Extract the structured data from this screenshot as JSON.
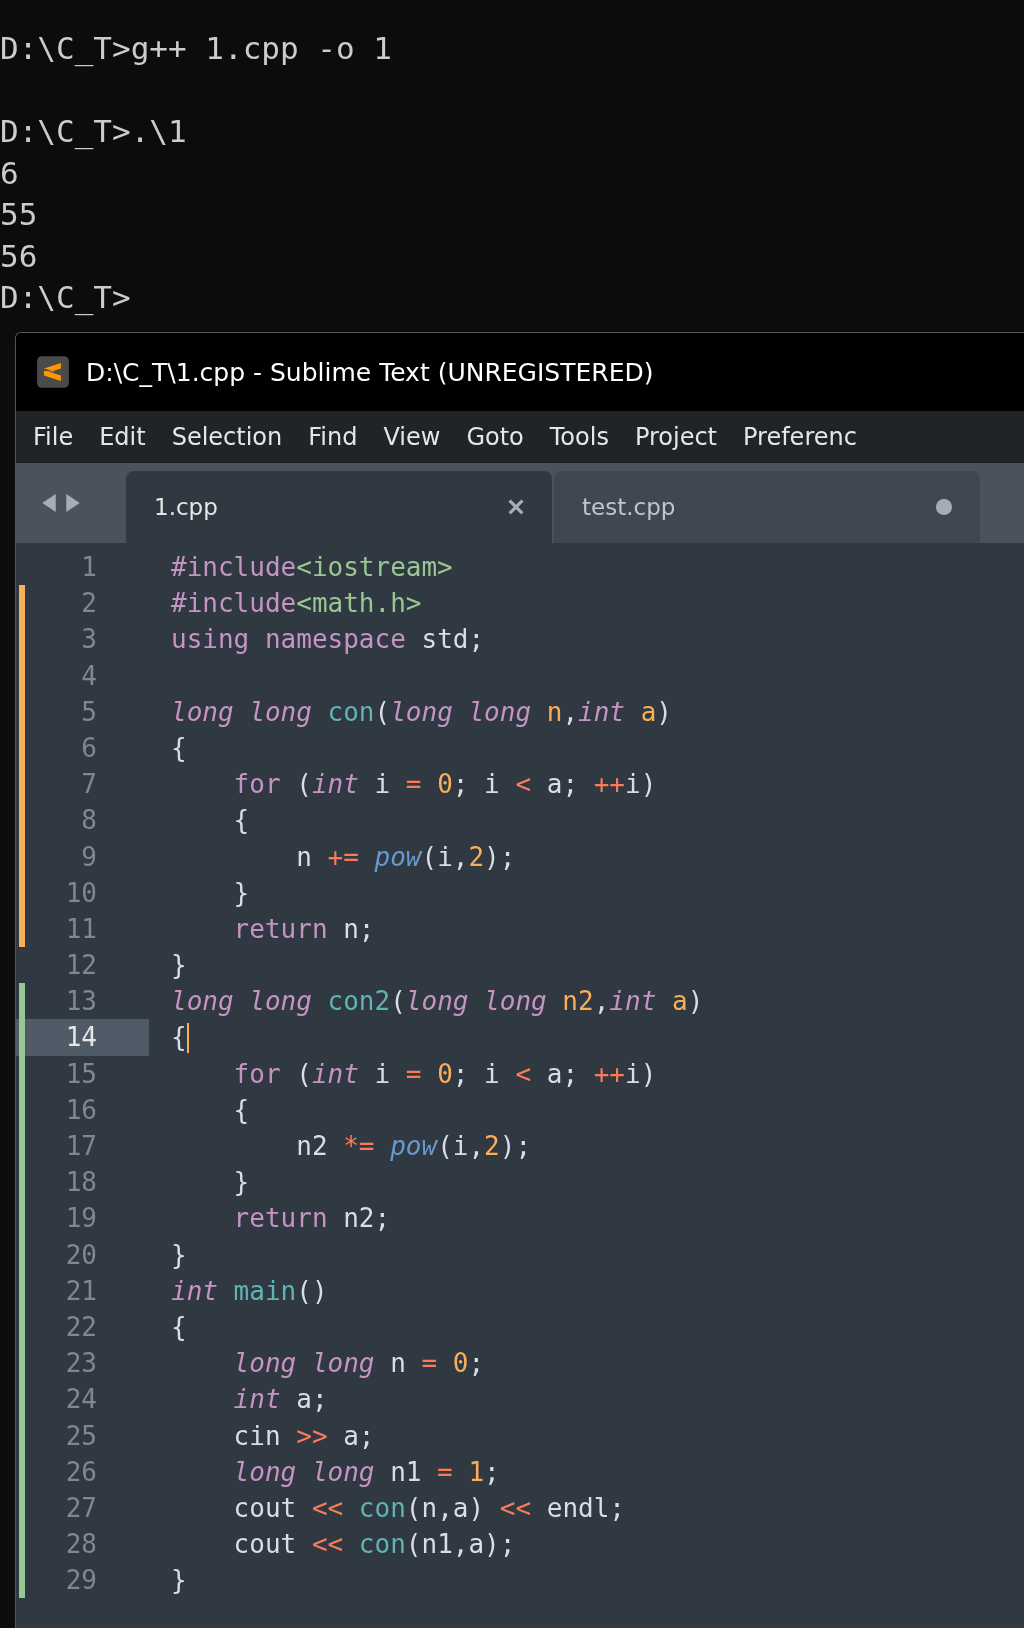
{
  "terminal": {
    "blocks": [
      {
        "lines": [
          "D:\\C_T>g++ 1.cpp -o 1"
        ]
      },
      {
        "lines": [
          "D:\\C_T>.\\1",
          "6",
          "55",
          "56",
          "D:\\C_T>"
        ]
      }
    ]
  },
  "window": {
    "title": "D:\\C_T\\1.cpp - Sublime Text (UNREGISTERED)"
  },
  "menu": [
    "File",
    "Edit",
    "Selection",
    "Find",
    "View",
    "Goto",
    "Tools",
    "Project",
    "Preferenc"
  ],
  "tabs": [
    {
      "label": "1.cpp",
      "selected": true,
      "dirty": false
    },
    {
      "label": "test.cpp",
      "selected": false,
      "dirty": true
    }
  ],
  "editor": {
    "lines": [
      {
        "number": "1",
        "modified": false,
        "added": false,
        "current": false,
        "tokens": [
          {
            "kind": "kw",
            "text": "#include"
          },
          {
            "kind": "str",
            "text": "<iostream>"
          }
        ]
      },
      {
        "number": "2",
        "modified": true,
        "added": false,
        "current": false,
        "tokens": [
          {
            "kind": "kw",
            "text": "#include"
          },
          {
            "kind": "str",
            "text": "<math.h>"
          }
        ]
      },
      {
        "number": "3",
        "modified": true,
        "added": false,
        "current": false,
        "tokens": [
          {
            "kind": "kw",
            "text": "using"
          },
          {
            "kind": "kw",
            "text": " namespace"
          },
          {
            "kind": "plain",
            "text": " std;"
          }
        ]
      },
      {
        "number": "4",
        "modified": true,
        "added": false,
        "current": false
      },
      {
        "number": "5",
        "modified": true,
        "added": false,
        "current": false,
        "tokens": [
          {
            "kind": "type",
            "text": "long long"
          },
          {
            "kind": "fn",
            "text": " con"
          },
          {
            "kind": "plain",
            "text": "("
          },
          {
            "kind": "type",
            "text": "long long"
          },
          {
            "kind": "param",
            "text": " n"
          },
          {
            "kind": "plain",
            "text": ","
          },
          {
            "kind": "type",
            "text": "int"
          },
          {
            "kind": "param",
            "text": " a"
          },
          {
            "kind": "plain",
            "text": ")"
          }
        ]
      },
      {
        "number": "6",
        "modified": true,
        "added": false,
        "current": false,
        "tokens": [
          {
            "kind": "plain",
            "text": "{"
          }
        ]
      },
      {
        "number": "7",
        "modified": true,
        "added": false,
        "current": false,
        "tokens": [
          {
            "kind": "kw",
            "text": "    for"
          },
          {
            "kind": "plain",
            "text": " ("
          },
          {
            "kind": "type",
            "text": "int"
          },
          {
            "kind": "plain",
            "text": " i"
          },
          {
            "kind": "op",
            "text": " ="
          },
          {
            "kind": "num",
            "text": " 0"
          },
          {
            "kind": "plain",
            "text": "; i"
          },
          {
            "kind": "op",
            "text": " <"
          },
          {
            "kind": "plain",
            "text": " a;"
          },
          {
            "kind": "op",
            "text": " ++"
          },
          {
            "kind": "plain",
            "text": "i)"
          }
        ]
      },
      {
        "number": "8",
        "modified": true,
        "added": false,
        "current": false,
        "tokens": [
          {
            "kind": "plain",
            "text": "    {"
          }
        ]
      },
      {
        "number": "9",
        "modified": true,
        "added": false,
        "current": false,
        "tokens": [
          {
            "kind": "plain",
            "text": "        n"
          },
          {
            "kind": "op",
            "text": " +="
          },
          {
            "kind": "lib",
            "text": " pow"
          },
          {
            "kind": "plain",
            "text": "(i,"
          },
          {
            "kind": "num",
            "text": "2"
          },
          {
            "kind": "plain",
            "text": ");"
          }
        ]
      },
      {
        "number": "10",
        "modified": true,
        "added": false,
        "current": false,
        "tokens": [
          {
            "kind": "plain",
            "text": "    }"
          }
        ]
      },
      {
        "number": "11",
        "modified": true,
        "added": false,
        "current": false,
        "tokens": [
          {
            "kind": "kw",
            "text": "    return"
          },
          {
            "kind": "plain",
            "text": " n;"
          }
        ]
      },
      {
        "number": "12",
        "modified": false,
        "added": false,
        "current": false,
        "tokens": [
          {
            "kind": "plain",
            "text": "}"
          }
        ]
      },
      {
        "number": "13",
        "modified": false,
        "added": true,
        "current": false,
        "tokens": [
          {
            "kind": "type",
            "text": "long long"
          },
          {
            "kind": "fn",
            "text": " con2"
          },
          {
            "kind": "plain",
            "text": "("
          },
          {
            "kind": "type",
            "text": "long long"
          },
          {
            "kind": "param",
            "text": " n2"
          },
          {
            "kind": "plain",
            "text": ","
          },
          {
            "kind": "type",
            "text": "int"
          },
          {
            "kind": "param",
            "text": " a"
          },
          {
            "kind": "plain",
            "text": ")"
          }
        ]
      },
      {
        "number": "14",
        "modified": false,
        "added": true,
        "current": true,
        "tokens": [
          {
            "kind": "plain",
            "text": "{"
          }
        ]
      },
      {
        "number": "15",
        "modified": false,
        "added": true,
        "current": false,
        "tokens": [
          {
            "kind": "kw",
            "text": "    for"
          },
          {
            "kind": "plain",
            "text": " ("
          },
          {
            "kind": "type",
            "text": "int"
          },
          {
            "kind": "plain",
            "text": " i"
          },
          {
            "kind": "op",
            "text": " ="
          },
          {
            "kind": "num",
            "text": " 0"
          },
          {
            "kind": "plain",
            "text": "; i"
          },
          {
            "kind": "op",
            "text": " <"
          },
          {
            "kind": "plain",
            "text": " a;"
          },
          {
            "kind": "op",
            "text": " ++"
          },
          {
            "kind": "plain",
            "text": "i)"
          }
        ]
      },
      {
        "number": "16",
        "modified": false,
        "added": true,
        "current": false,
        "tokens": [
          {
            "kind": "plain",
            "text": "    {"
          }
        ]
      },
      {
        "number": "17",
        "modified": false,
        "added": true,
        "current": false,
        "tokens": [
          {
            "kind": "plain",
            "text": "        n2"
          },
          {
            "kind": "op",
            "text": " *="
          },
          {
            "kind": "lib",
            "text": " pow"
          },
          {
            "kind": "plain",
            "text": "(i,"
          },
          {
            "kind": "num",
            "text": "2"
          },
          {
            "kind": "plain",
            "text": ");"
          }
        ]
      },
      {
        "number": "18",
        "modified": false,
        "added": true,
        "current": false,
        "tokens": [
          {
            "kind": "plain",
            "text": "    }"
          }
        ]
      },
      {
        "number": "19",
        "modified": false,
        "added": true,
        "current": false,
        "tokens": [
          {
            "kind": "kw",
            "text": "    return"
          },
          {
            "kind": "plain",
            "text": " n2;"
          }
        ]
      },
      {
        "number": "20",
        "modified": false,
        "added": true,
        "current": false,
        "tokens": [
          {
            "kind": "plain",
            "text": "}"
          }
        ]
      },
      {
        "number": "21",
        "modified": false,
        "added": true,
        "current": false,
        "tokens": [
          {
            "kind": "type",
            "text": "int"
          },
          {
            "kind": "fn",
            "text": " main"
          },
          {
            "kind": "plain",
            "text": "()"
          }
        ]
      },
      {
        "number": "22",
        "modified": false,
        "added": true,
        "current": false,
        "tokens": [
          {
            "kind": "plain",
            "text": "{"
          }
        ]
      },
      {
        "number": "23",
        "modified": false,
        "added": true,
        "current": false,
        "tokens": [
          {
            "kind": "type",
            "text": "    long long"
          },
          {
            "kind": "plain",
            "text": " n"
          },
          {
            "kind": "op",
            "text": " ="
          },
          {
            "kind": "num",
            "text": " 0"
          },
          {
            "kind": "plain",
            "text": ";"
          }
        ]
      },
      {
        "number": "24",
        "modified": false,
        "added": true,
        "current": false,
        "tokens": [
          {
            "kind": "type",
            "text": "    int"
          },
          {
            "kind": "plain",
            "text": " a;"
          }
        ]
      },
      {
        "number": "25",
        "modified": false,
        "added": true,
        "current": false,
        "tokens": [
          {
            "kind": "plain",
            "text": "    cin"
          },
          {
            "kind": "op",
            "text": " >>"
          },
          {
            "kind": "plain",
            "text": " a;"
          }
        ]
      },
      {
        "number": "26",
        "modified": false,
        "added": true,
        "current": false,
        "tokens": [
          {
            "kind": "type",
            "text": "    long long"
          },
          {
            "kind": "plain",
            "text": " n1"
          },
          {
            "kind": "op",
            "text": " ="
          },
          {
            "kind": "num",
            "text": " 1"
          },
          {
            "kind": "plain",
            "text": ";"
          }
        ]
      },
      {
        "number": "27",
        "modified": false,
        "added": true,
        "current": false,
        "tokens": [
          {
            "kind": "plain",
            "text": "    cout"
          },
          {
            "kind": "op",
            "text": " <<"
          },
          {
            "kind": "fn",
            "text": " con"
          },
          {
            "kind": "plain",
            "text": "(n,a)"
          },
          {
            "kind": "op",
            "text": " <<"
          },
          {
            "kind": "plain",
            "text": " endl;"
          }
        ]
      },
      {
        "number": "28",
        "modified": false,
        "added": true,
        "current": false,
        "tokens": [
          {
            "kind": "plain",
            "text": "    cout"
          },
          {
            "kind": "op",
            "text": " <<"
          },
          {
            "kind": "fn",
            "text": " con"
          },
          {
            "kind": "plain",
            "text": "(n1,a);"
          }
        ]
      },
      {
        "number": "29",
        "modified": false,
        "added": true,
        "current": false,
        "tokens": [
          {
            "kind": "plain",
            "text": "}"
          }
        ]
      }
    ]
  }
}
